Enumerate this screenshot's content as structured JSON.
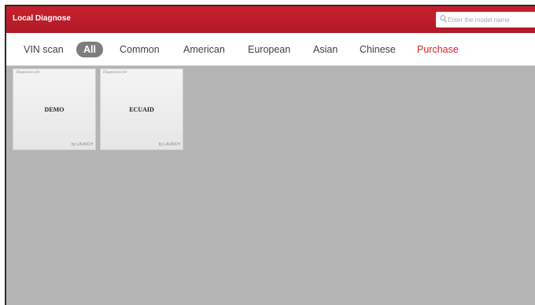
{
  "header": {
    "title": "Local Diagnose",
    "search_placeholder": "Enter the model name",
    "accent_color": "#c41e2c"
  },
  "tabs": [
    {
      "label": "VIN scan"
    },
    {
      "label": "All",
      "active": true
    },
    {
      "label": "Common"
    },
    {
      "label": "American"
    },
    {
      "label": "European"
    },
    {
      "label": "Asian"
    },
    {
      "label": "Chinese"
    },
    {
      "label": "Purchase",
      "color": "#d1252f"
    }
  ],
  "cards": [
    {
      "top_text": "Diagnostics for",
      "name": "DEMO",
      "by": "by LAUNCH"
    },
    {
      "top_text": "Diagnostics for",
      "name": "ECUAID",
      "by": "by LAUNCH"
    }
  ],
  "icons": {
    "search": "magnifier"
  }
}
